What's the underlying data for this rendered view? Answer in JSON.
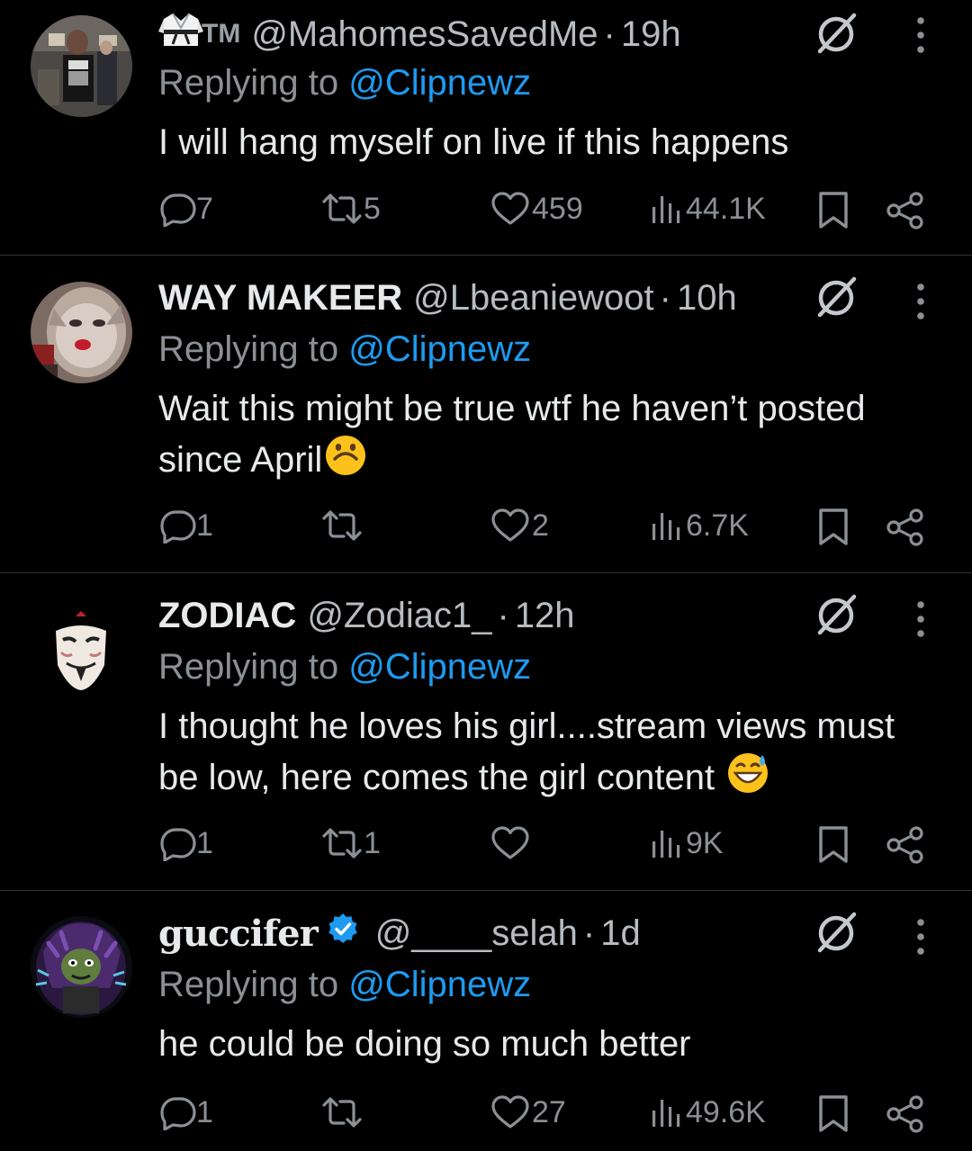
{
  "tweets": [
    {
      "name": "",
      "name_prefix_icon": "karate-gi-emoji-icon",
      "name_suffix": "TM",
      "handle": "@MahomesSavedMe",
      "dot": "·",
      "time": "19h",
      "replying_prefix": "Replying to ",
      "replying_to": "@Clipnewz",
      "text": "I will hang myself on live if this happens",
      "replies": "7",
      "retweets": "5",
      "likes": "459",
      "views": "44.1K"
    },
    {
      "name": "WAY MAKEER",
      "handle": "@Lbeaniewoot",
      "dot": "·",
      "time": "10h",
      "replying_prefix": "Replying to ",
      "replying_to": "@Clipnewz",
      "text_line1": "Wait this might be true wtf he haven’t posted",
      "text_line2": "since April",
      "emoji": "upside-down-face-emoji-icon",
      "replies": "1",
      "retweets": "",
      "likes": "2",
      "views": "6.7K"
    },
    {
      "name": "ZODIAC",
      "handle": "@Zodiac1_",
      "dot": "·",
      "time": "12h",
      "replying_prefix": "Replying to ",
      "replying_to": "@Clipnewz",
      "text_line1": "I thought he loves his girl....stream views must",
      "text_line2": "be low, here comes the girl content ",
      "emoji": "grinning-sweat-emoji-icon",
      "replies": "1",
      "retweets": "1",
      "likes": "",
      "views": "9K"
    },
    {
      "name": "guccifer",
      "verified": true,
      "handle": "@____selah",
      "dot": "·",
      "time": "1d",
      "replying_prefix": "Replying to ",
      "replying_to": "@Clipnewz",
      "text": "he could be doing so much better",
      "replies": "1",
      "retweets": "",
      "likes": "27",
      "views": "49.6K"
    }
  ],
  "colors": {
    "background": "#000000",
    "text": "#e7e9ea",
    "secondary": "#8b9095",
    "link": "#1d9bf0",
    "separator": "#2f3336",
    "verified": "#1d9bf0"
  }
}
